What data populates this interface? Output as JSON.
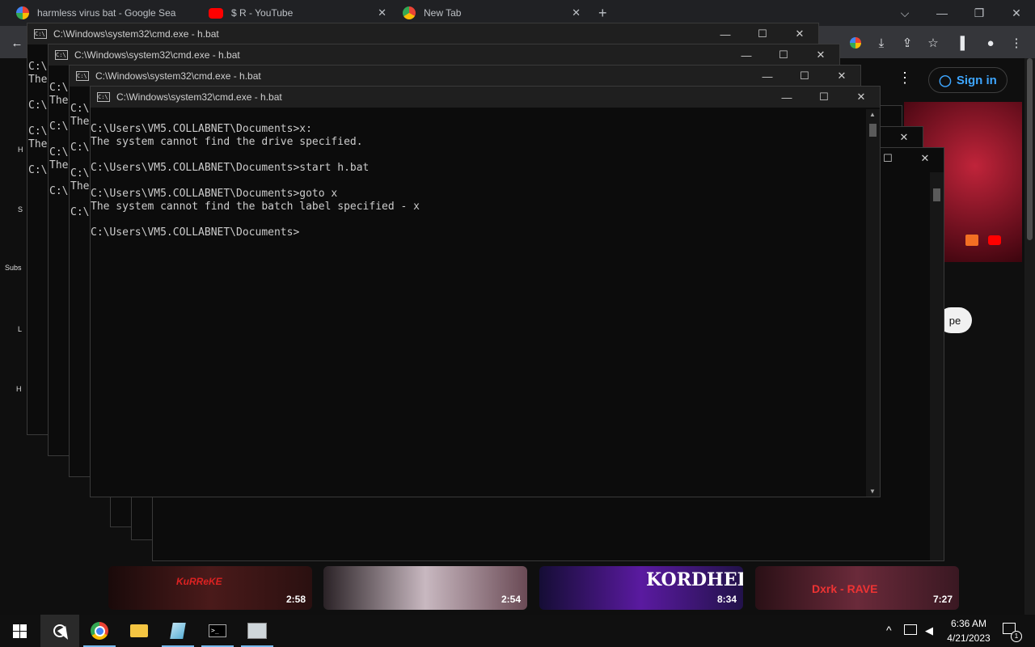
{
  "browser": {
    "tabs": [
      {
        "title": "harmless virus bat - Google Sea",
        "icon": "google-icon"
      },
      {
        "title": "$ R - YouTube",
        "icon": "youtube-icon"
      },
      {
        "title": "New Tab",
        "icon": "chrome-icon"
      }
    ],
    "close_glyph": "✕",
    "new_tab_glyph": "+",
    "window_controls": {
      "menu": "⌵",
      "minimize": "—",
      "restore": "❐",
      "close": "✕"
    }
  },
  "youtube": {
    "signin_label": "Sign in",
    "partial_button_text": "pe",
    "sidebar_fragments": [
      "H",
      "S",
      "Subs",
      "L",
      "H"
    ],
    "videos": [
      {
        "duration": "2:58",
        "overlay": "KuRReKE",
        "color": "#4a1a1a"
      },
      {
        "duration": "2:54",
        "overlay": "",
        "color": "#6a4a55"
      },
      {
        "duration": "8:34",
        "overlay": "KORDHELL",
        "color": "#3a1a6a"
      },
      {
        "duration": "7:27",
        "overlay": "Dxrk - RAVE",
        "color": "#5a2a3a"
      }
    ]
  },
  "cmd": {
    "title": "C:\\Windows\\system32\\cmd.exe - h.bat",
    "front_lines": [
      "C:\\Users\\VM5.COLLABNET\\Documents>x:",
      "The system cannot find the drive specified.",
      "",
      "C:\\Users\\VM5.COLLABNET\\Documents>start h.bat",
      "",
      "C:\\Users\\VM5.COLLABNET\\Documents>goto x",
      "The system cannot find the batch label specified - x",
      "",
      "C:\\Users\\VM5.COLLABNET\\Documents>"
    ],
    "bg_fragments": [
      "C:\\",
      "The",
      "C:\\",
      "C:\\",
      "The",
      "C:\\"
    ],
    "ctl_minimize": "—",
    "ctl_maximize": "☐",
    "ctl_close": "✕"
  },
  "taskbar": {
    "apps": [
      "windows-start-icon",
      "search-icon",
      "chrome-icon",
      "file-explorer-icon",
      "notepad-icon",
      "cmd-icon",
      "app-icon"
    ],
    "time": "6:36 AM",
    "date": "4/21/2023",
    "tray_chevron": "^",
    "notification_count": "1"
  }
}
